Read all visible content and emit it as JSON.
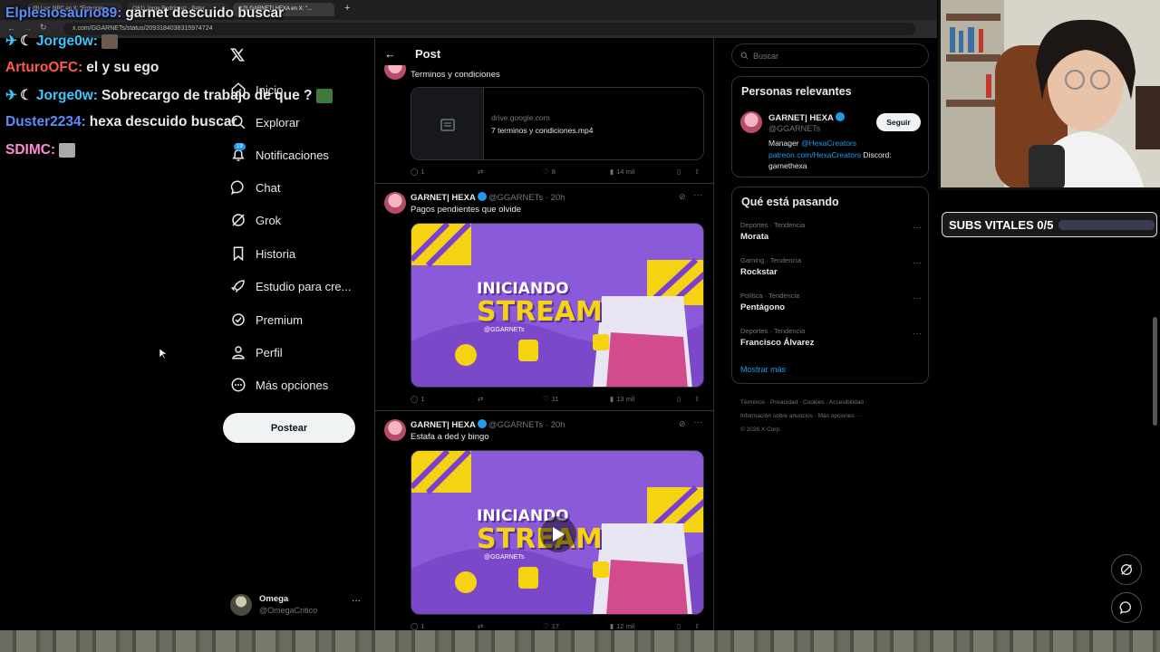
{
  "browser": {
    "tabs": [
      "(9) Luz: NPC en X: \"Entonces...",
      "(261) Jorge Rodríguez - Peter...",
      "(10) GARNET| HEXA en X: \"..."
    ],
    "url": "x.com/GGARNETs/status/2093184038315974724"
  },
  "stream_chat": [
    {
      "user": "Elplesiosaurio89:",
      "message": "garnet descuido buscar",
      "color": "#5b8dff"
    },
    {
      "user": "Jorge0w:",
      "message": "",
      "color": "#3cc6ff",
      "badges": true
    },
    {
      "user": "ArturoOFC:",
      "message": "el y su ego",
      "color": "#ff5a4a"
    },
    {
      "user": "Jorge0w:",
      "message": "Sobrecargo de trabajo de que ?",
      "color": "#3cc6ff",
      "badges": true
    },
    {
      "user": "Duster2234:",
      "message": "hexa descuido buscar",
      "color": "#5b8dff"
    },
    {
      "user": "SDIMC:",
      "message": "",
      "color": "#ff8ad8"
    }
  ],
  "sidebar": {
    "items": [
      {
        "label": "Inicio",
        "icon": "home-icon"
      },
      {
        "label": "Explorar",
        "icon": "search-icon"
      },
      {
        "label": "Notificaciones",
        "icon": "bell-icon",
        "badge": "19"
      },
      {
        "label": "Chat",
        "icon": "chat-icon"
      },
      {
        "label": "Grok",
        "icon": "grok-icon"
      },
      {
        "label": "Historia",
        "icon": "bookmark-icon"
      },
      {
        "label": "Estudio para cre...",
        "icon": "rocket-icon"
      },
      {
        "label": "Premium",
        "icon": "premium-icon"
      },
      {
        "label": "Perfil",
        "icon": "person-icon"
      },
      {
        "label": "Más opciones",
        "icon": "more-circle-icon"
      }
    ],
    "post_button": "Postear",
    "account": {
      "name": "Omega",
      "handle": "@OmegaCritico"
    }
  },
  "header": {
    "title": "Post"
  },
  "posts": [
    {
      "text": "Terminos y condiciones",
      "link_card": {
        "domain": "drive.google.com",
        "title": "7 terminos y condiciones.mp4"
      },
      "stats": {
        "replies": "1",
        "likes": "8",
        "views": "14 mil"
      }
    },
    {
      "author": "GARNET| HEXA",
      "handle": "@GGARNETs",
      "time": "· 20h",
      "text": "Pagos pendientes que olvide",
      "media": {
        "line1": "INICIANDO",
        "line2": "STREAM",
        "tag": "@GGARNETs"
      },
      "stats": {
        "replies": "1",
        "likes": "11",
        "views": "13 mil"
      }
    },
    {
      "author": "GARNET| HEXA",
      "handle": "@GGARNETs",
      "time": "· 20h",
      "text": "Estafa a ded y bingo",
      "media": {
        "line1": "INICIANDO",
        "line2": "STREAM",
        "tag": "@GGARNETs"
      },
      "stats": {
        "replies": "1",
        "likes": "17",
        "views": "12 mil"
      }
    }
  ],
  "search": {
    "placeholder": "Buscar"
  },
  "relevant": {
    "title": "Personas relevantes",
    "name": "GARNET| HEXA",
    "handle": "@GGARNETs",
    "follow": "Seguir",
    "bio_prefix": "Manager",
    "bio_link1": "@HexaCreators",
    "bio_link2": "patreon.com/HexaCreators",
    "bio_suffix": "Discord: garnethexa"
  },
  "trending": {
    "title": "Qué está pasando",
    "items": [
      {
        "category": "Deportes · Tendencia",
        "name": "Morata"
      },
      {
        "category": "Gaming · Tendencia",
        "name": "Rockstar"
      },
      {
        "category": "Política · Tendencia",
        "name": "Pentágono"
      },
      {
        "category": "Deportes · Tendencia",
        "name": "Francisco Álvarez"
      }
    ],
    "show_more": "Mostrar más"
  },
  "footer": {
    "line1": "Términos · Privacidad · Cookies · Accesibilidad ·",
    "line2": "Información sobre anuncios · Más opciones ···",
    "line3": "© 2026 X Corp."
  },
  "overlay": {
    "subs_label": "SUBS VITALES 0/5",
    "subs_progress": 0
  },
  "colors": {
    "accent": "#1d9bf0",
    "media_purple": "#8a5ad8",
    "media_yellow": "#f5d312"
  }
}
